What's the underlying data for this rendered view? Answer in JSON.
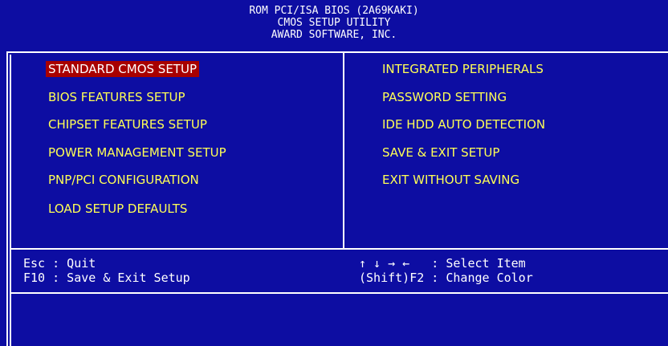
{
  "header": {
    "line1": "ROM PCI/ISA BIOS (2A69KAKI)",
    "line2": "CMOS SETUP UTILITY",
    "line3": "AWARD SOFTWARE, INC."
  },
  "menu_left": [
    {
      "label": "STANDARD CMOS SETUP",
      "selected": true
    },
    {
      "label": "BIOS FEATURES SETUP"
    },
    {
      "label": "CHIPSET FEATURES SETUP"
    },
    {
      "label": "POWER MANAGEMENT SETUP"
    },
    {
      "label": "PNP/PCI CONFIGURATION"
    },
    {
      "label": "LOAD SETUP DEFAULTS"
    }
  ],
  "menu_right": [
    {
      "label": "INTEGRATED PERIPHERALS"
    },
    {
      "label": "PASSWORD SETTING"
    },
    {
      "label": "IDE HDD AUTO DETECTION"
    },
    {
      "label": "SAVE & EXIT SETUP"
    },
    {
      "label": "EXIT WITHOUT SAVING"
    }
  ],
  "hints": {
    "esc": "Esc : Quit",
    "f10": "F10 : Save & Exit Setup",
    "select": "↑ ↓ → ←   : Select Item",
    "color": "(Shift)F2 : Change Color"
  },
  "colors": {
    "background": "#0d0da2",
    "menu_text": "#ffff55",
    "selected_bg": "#a80000",
    "selected_text": "#ffffff",
    "border": "#ffffff"
  }
}
